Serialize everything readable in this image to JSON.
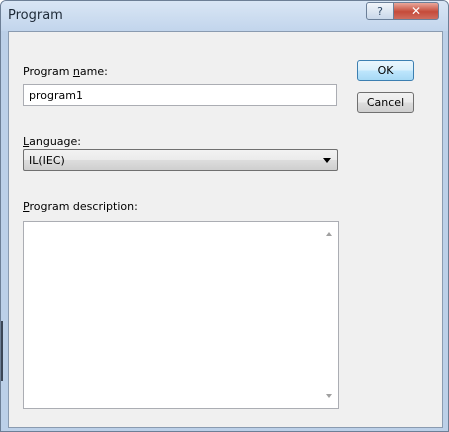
{
  "window": {
    "title": "Program",
    "help_glyph": "?",
    "close_glyph": "✕"
  },
  "form": {
    "program_name_label_pre": "Program ",
    "program_name_label_accel": "n",
    "program_name_label_post": "ame:",
    "program_name_value": "program1",
    "language_label_accel": "L",
    "language_label_post": "anguage:",
    "language_value": "IL(IEC)",
    "description_label_accel": "P",
    "description_label_post": "rogram description:",
    "description_value": ""
  },
  "buttons": {
    "ok": "OK",
    "cancel": "Cancel"
  },
  "icons": {
    "help": "question-icon",
    "close": "close-icon",
    "dropdown": "chevron-down-icon",
    "scroll_up": "scroll-up-icon",
    "scroll_down": "scroll-down-icon"
  }
}
